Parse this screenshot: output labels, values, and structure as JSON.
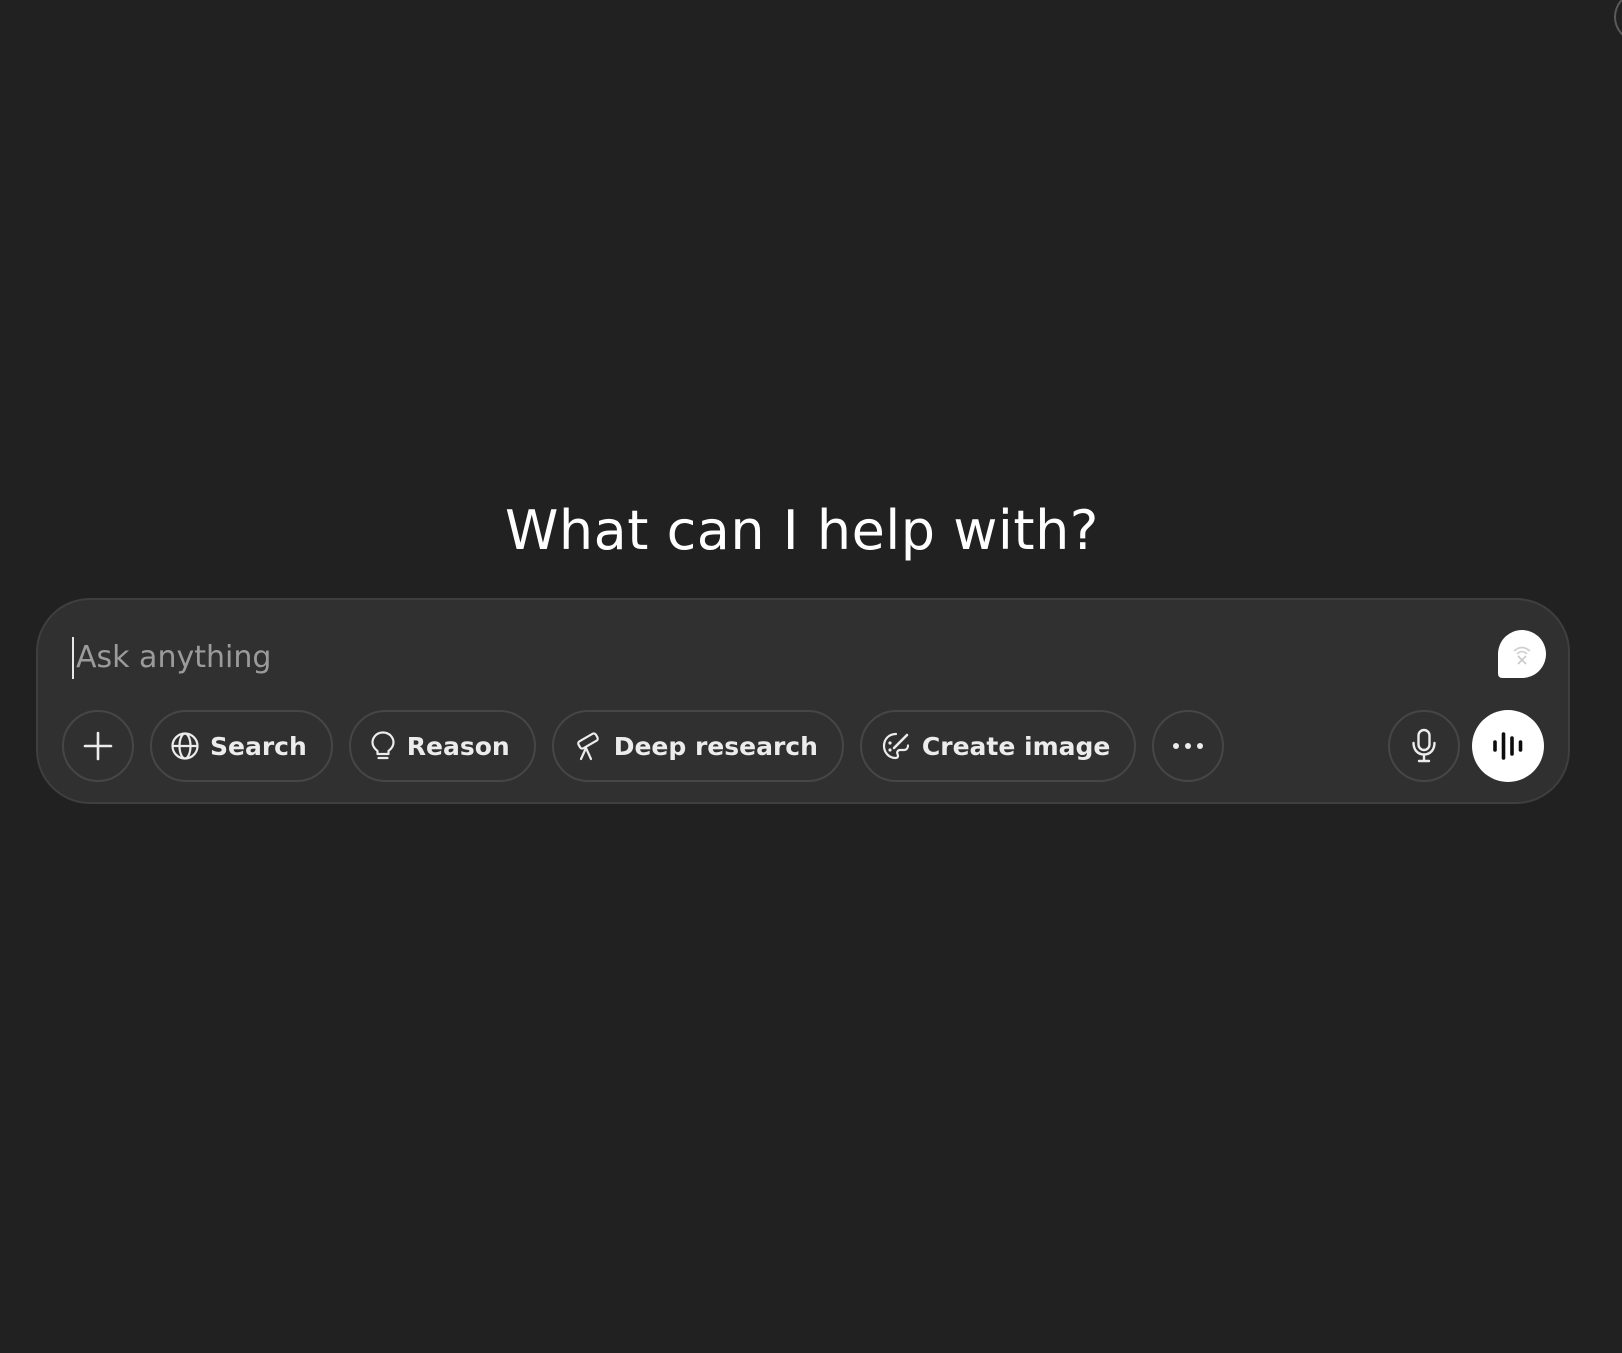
{
  "main": {
    "headline": "What can I help with?"
  },
  "composer": {
    "placeholder": "Ask anything",
    "tools": [
      {
        "label": "Search",
        "icon": "globe-icon"
      },
      {
        "label": "Reason",
        "icon": "lightbulb-icon"
      },
      {
        "label": "Deep research",
        "icon": "telescope-icon"
      },
      {
        "label": "Create image",
        "icon": "paint-brush-icon"
      }
    ],
    "buttons": {
      "attach": {
        "icon": "plus-icon"
      },
      "more": {
        "icon": "ellipsis-icon"
      },
      "dictate": {
        "icon": "microphone-icon"
      },
      "voice_mode": {
        "icon": "sound-wave-icon"
      }
    },
    "extension_badge": {
      "icon": "extension-bubble-icon"
    }
  },
  "colors": {
    "background": "#212121",
    "composer_bg": "#303030",
    "border": "#464646",
    "text": "#ececec",
    "placeholder": "#9b9b9b",
    "voice_button_bg": "#ffffff"
  }
}
